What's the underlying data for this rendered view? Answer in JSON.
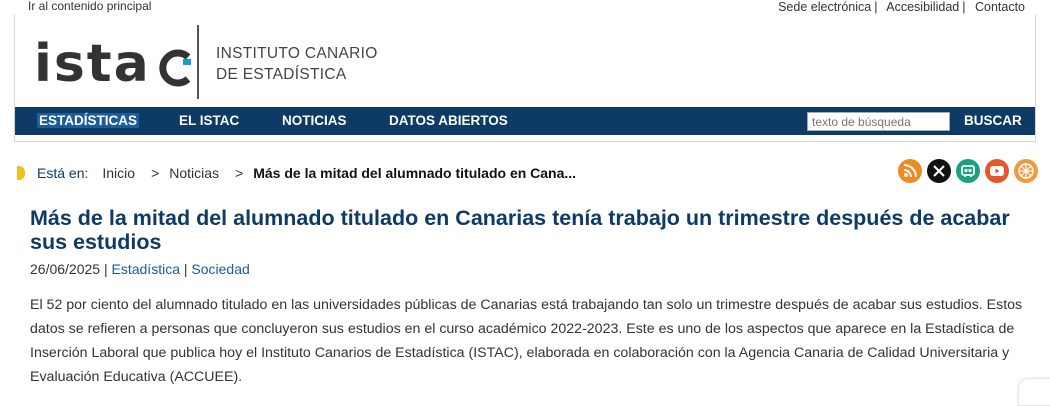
{
  "skip_link": "Ir al contenido principal",
  "top_links": [
    "Sede electrónica",
    "Accesibilidad",
    "Contacto"
  ],
  "logo": {
    "wordmark": "istac",
    "line1": "INSTITUTO CANARIO",
    "line2": "DE ESTADÍSTICA"
  },
  "nav": {
    "items": [
      "ESTADÍSTICAS",
      "EL ISTAC",
      "NOTICIAS",
      "DATOS ABIERTOS"
    ],
    "search_placeholder": "texto de búsqueda",
    "search_button": "BUSCAR"
  },
  "breadcrumb": {
    "label": "Está en:",
    "items": [
      "Inicio",
      "Noticias"
    ],
    "current": "Más de la mitad del alumnado titulado en Cana..."
  },
  "social_icons": [
    "rss-icon",
    "x-icon",
    "flickr-icon",
    "youtube-icon",
    "pinwheel-icon"
  ],
  "colors": {
    "navy": "#0d3b66",
    "active": "#1c5b9c",
    "rss": "#f08a24",
    "youtube": "#e4572e",
    "pinwheel": "#f09a3e",
    "flickr": "#1aa080"
  },
  "article": {
    "title": "Más de la mitad del alumnado titulado en Canarias tenía trabajo un trimestre después de acabar sus estudios",
    "date": "26/06/2025",
    "categories": [
      "Estadística",
      "Sociedad"
    ],
    "body": "El 52 por ciento del alumnado titulado en las universidades públicas de Canarias está trabajando tan solo un trimestre después de acabar sus estudios. Estos datos se refieren a personas que concluyeron sus estudios en el curso académico 2022-2023. Este es uno de los aspectos que aparece en la Estadística de Inserción Laboral que publica hoy el Instituto Canarios de Estadística (ISTAC), elaborada en colaboración con la Agencia Canaria de Calidad Universitaria y Evaluación Educativa (ACCUEE)."
  }
}
